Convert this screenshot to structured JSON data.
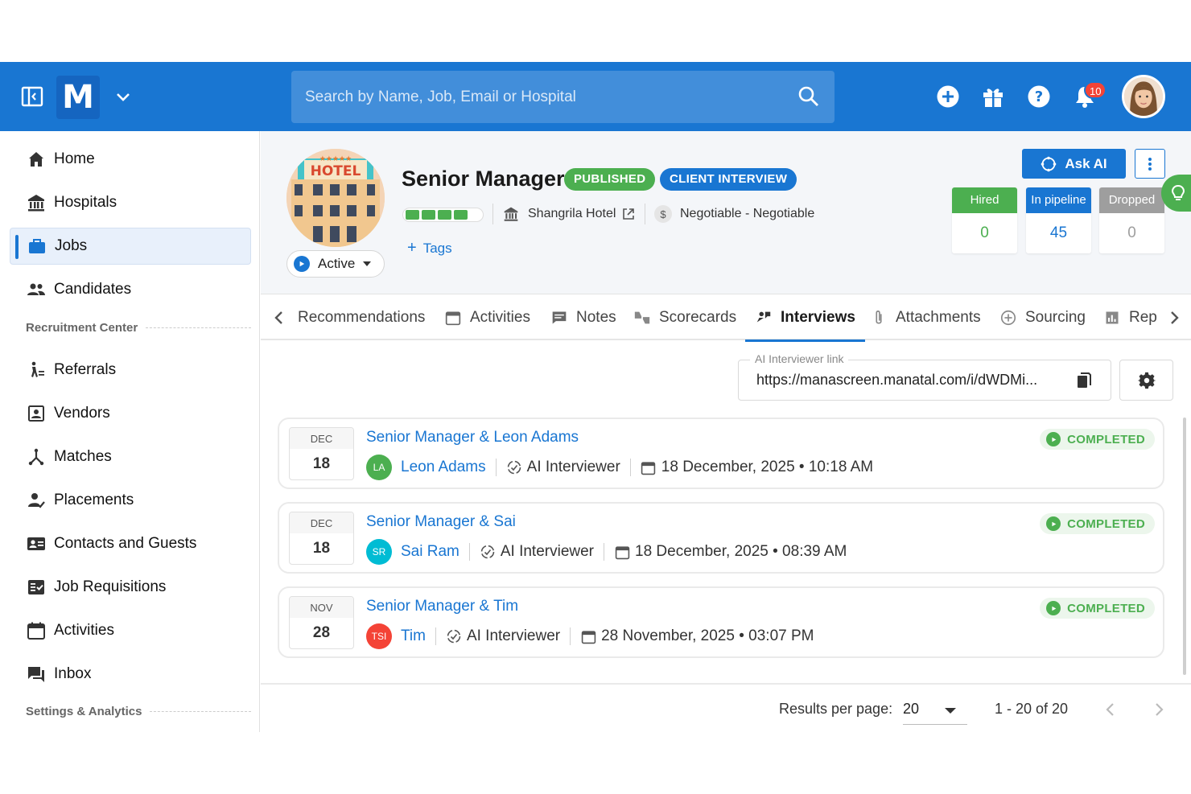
{
  "topbar": {
    "logo_letter": "M",
    "search_placeholder": "Search by Name, Job, Email or Hospital",
    "notification_count": "10",
    "colors": {
      "primary": "#1976d2"
    }
  },
  "sidebar": {
    "items": [
      {
        "label": "Home",
        "icon": "home-icon"
      },
      {
        "label": "Hospitals",
        "icon": "building-icon"
      },
      {
        "label": "Jobs",
        "icon": "briefcase-icon"
      },
      {
        "label": "Candidates",
        "icon": "people-icon"
      },
      {
        "label": "Referrals",
        "icon": "referral-icon"
      },
      {
        "label": "Vendors",
        "icon": "vendor-icon"
      },
      {
        "label": "Matches",
        "icon": "matches-icon"
      },
      {
        "label": "Placements",
        "icon": "placement-icon"
      },
      {
        "label": "Contacts and Guests",
        "icon": "contact-card-icon"
      },
      {
        "label": "Job Requisitions",
        "icon": "checklist-icon"
      },
      {
        "label": "Activities",
        "icon": "calendar-icon"
      },
      {
        "label": "Inbox",
        "icon": "inbox-icon"
      }
    ],
    "section_recruitment": "Recruitment Center",
    "section_settings": "Settings & Analytics",
    "active_item": "Jobs"
  },
  "job": {
    "logo_text": "HOTEL",
    "title": "Senior Manager",
    "chip_published": "PUBLISHED",
    "chip_stage": "CLIENT INTERVIEW",
    "status": "Active",
    "progress_segments": 4,
    "progress_total": 5,
    "hospital": "Shangrila Hotel",
    "salary": "Negotiable - Negotiable",
    "currency_symbol": "$",
    "tags_label": "Tags",
    "ask_ai_label": "Ask AI",
    "stats": {
      "hired": {
        "label": "Hired",
        "value": "0",
        "color": "#4caf50"
      },
      "pipeline": {
        "label": "In pipeline",
        "value": "45",
        "color": "#1976d2"
      },
      "dropped": {
        "label": "Dropped",
        "value": "0",
        "color": "#9e9e9e"
      }
    }
  },
  "tabs": [
    {
      "label": "Recommendations",
      "icon": ""
    },
    {
      "label": "Activities",
      "icon": "calendar-icon"
    },
    {
      "label": "Notes",
      "icon": "note-icon"
    },
    {
      "label": "Scorecards",
      "icon": "scorecard-icon"
    },
    {
      "label": "Interviews",
      "icon": "interview-icon",
      "active": true
    },
    {
      "label": "Attachments",
      "icon": "paperclip-icon"
    },
    {
      "label": "Sourcing",
      "icon": "plus-circle-icon"
    },
    {
      "label": "Rep",
      "icon": "report-icon"
    }
  ],
  "interviews": {
    "link_label": "AI Interviewer link",
    "link_value": "https://manascreen.manatal.com/i/dWDMi...",
    "items": [
      {
        "month": "DEC",
        "day": "18",
        "title": "Senior Manager & Leon Adams",
        "initials": "LA",
        "avatar_color": "#4caf50",
        "candidate": "Leon Adams",
        "interviewer": "AI Interviewer",
        "datetime": "18 December, 2025 • 10:18 AM",
        "status": "COMPLETED"
      },
      {
        "month": "DEC",
        "day": "18",
        "title": "Senior Manager & Sai",
        "initials": "SR",
        "avatar_color": "#00bcd4",
        "candidate": "Sai Ram",
        "interviewer": "AI Interviewer",
        "datetime": "18 December, 2025 • 08:39 AM",
        "status": "COMPLETED"
      },
      {
        "month": "NOV",
        "day": "28",
        "title": "Senior Manager & Tim",
        "initials": "TSI",
        "avatar_color": "#f44336",
        "candidate": "Tim",
        "interviewer": "AI Interviewer",
        "datetime": "28 November, 2025 • 03:07 PM",
        "status": "COMPLETED"
      }
    ]
  },
  "pagination": {
    "rpp_label": "Results per page:",
    "rpp_value": "20",
    "range": "1 - 20 of 20"
  }
}
